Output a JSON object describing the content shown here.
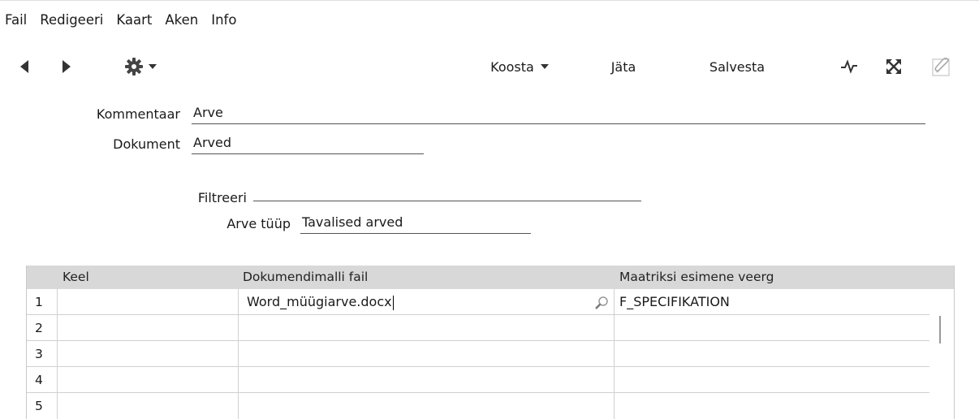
{
  "menu": [
    "Fail",
    "Redigeeri",
    "Kaart",
    "Aken",
    "Info"
  ],
  "toolbar": {
    "back_icon": "left-triangle-icon",
    "forward_icon": "right-triangle-icon",
    "settings_icon": "gear-icon",
    "koosta_label": "Koosta",
    "jata_label": "Jäta",
    "salvesta_label": "Salvesta",
    "pulse_icon": "pulse-icon",
    "expand_icon": "expand-icon",
    "attach_icon": "paperclip-icon"
  },
  "form": {
    "kommentaar_label": "Kommentaar",
    "kommentaar_value": "Arve",
    "dokument_label": "Dokument",
    "dokument_value": "Arved",
    "filtreeri_label": "Filtreeri",
    "filtreeri_value": "",
    "arve_tuup_label": "Arve tüüp",
    "arve_tuup_value": "Tavalised arved"
  },
  "grid": {
    "headers": [
      "Keel",
      "Dokumendimalli fail",
      "Maatriksi esimene veerg"
    ],
    "rows": [
      {
        "num": "1",
        "keel": "",
        "fail": "Word_müügiarve.docx",
        "veerg": "F_SPECIFIKATION"
      },
      {
        "num": "2",
        "keel": "",
        "fail": "",
        "veerg": ""
      },
      {
        "num": "3",
        "keel": "",
        "fail": "",
        "veerg": ""
      },
      {
        "num": "4",
        "keel": "",
        "fail": "",
        "veerg": ""
      },
      {
        "num": "5",
        "keel": "",
        "fail": "",
        "veerg": ""
      }
    ],
    "search_icon": "magnifier-icon"
  }
}
